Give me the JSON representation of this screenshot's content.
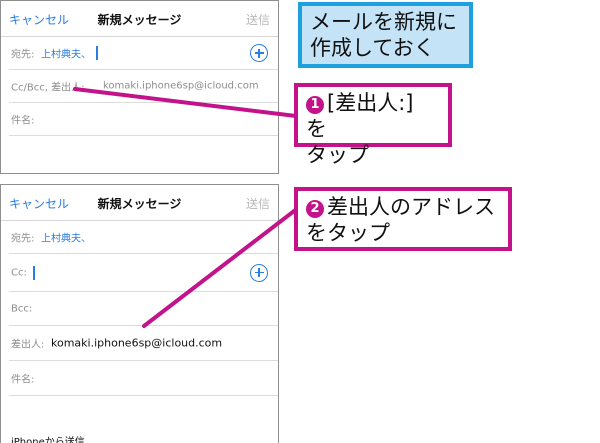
{
  "callouts": {
    "title_line1": "メールを新規に",
    "title_line2": "作成しておく",
    "step1_number": "1",
    "step1_line1": "[差出人:] を",
    "step1_line2": "タップ",
    "step2_number": "2",
    "step2_line1": "差出人のアドレス",
    "step2_line2": "をタップ"
  },
  "screen1": {
    "nav": {
      "cancel": "キャンセル",
      "title": "新規メッセージ",
      "send": "送信"
    },
    "to_label": "宛先:",
    "to_value": "上村典夫、",
    "ccbcc_label": "Cc/Bcc, 差出人:",
    "ccbcc_value": "komaki.iphone6sp@icloud.com",
    "subject_label": "件名:"
  },
  "screen2": {
    "nav": {
      "cancel": "キャンセル",
      "title": "新規メッセージ",
      "send": "送信"
    },
    "to_label": "宛先:",
    "to_value": "上村典夫、",
    "cc_label": "Cc:",
    "bcc_label": "Bcc:",
    "from_label": "差出人:",
    "from_value": "komaki.iphone6sp@icloud.com",
    "subject_label": "件名:",
    "signature": "iPhoneから送信"
  },
  "colors": {
    "accent": "#2a7de1",
    "callout_border": "#c3128a",
    "title_border": "#1ea0dc",
    "title_fill": "#c4e3f6"
  }
}
